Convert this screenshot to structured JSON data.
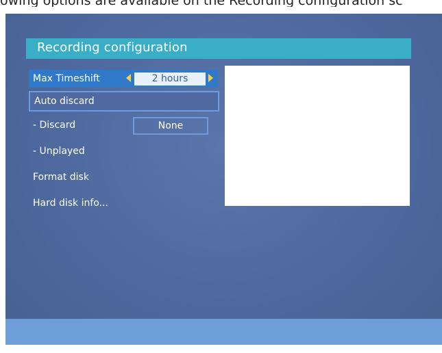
{
  "caption": "owing options are available on the Recording configuration sc",
  "screen": {
    "title": "Recording configuration",
    "menu": {
      "max_timeshift": {
        "label": "Max Timeshift",
        "value": "2 hours"
      },
      "auto_discard": {
        "label": "Auto discard"
      },
      "discard": {
        "label": "- Discard",
        "value": "None"
      },
      "unplayed": {
        "label": "- Unplayed"
      },
      "format_disk": {
        "label": "Format disk"
      },
      "hard_disk_info": {
        "label": "Hard disk info..."
      }
    }
  },
  "colors": {
    "background": "#4e6aa0",
    "title_bar": "#3aaec6",
    "selected_row": "#2f79c8",
    "arrow": "#f1d14a",
    "bottom_bar": "#6e9ed8"
  }
}
